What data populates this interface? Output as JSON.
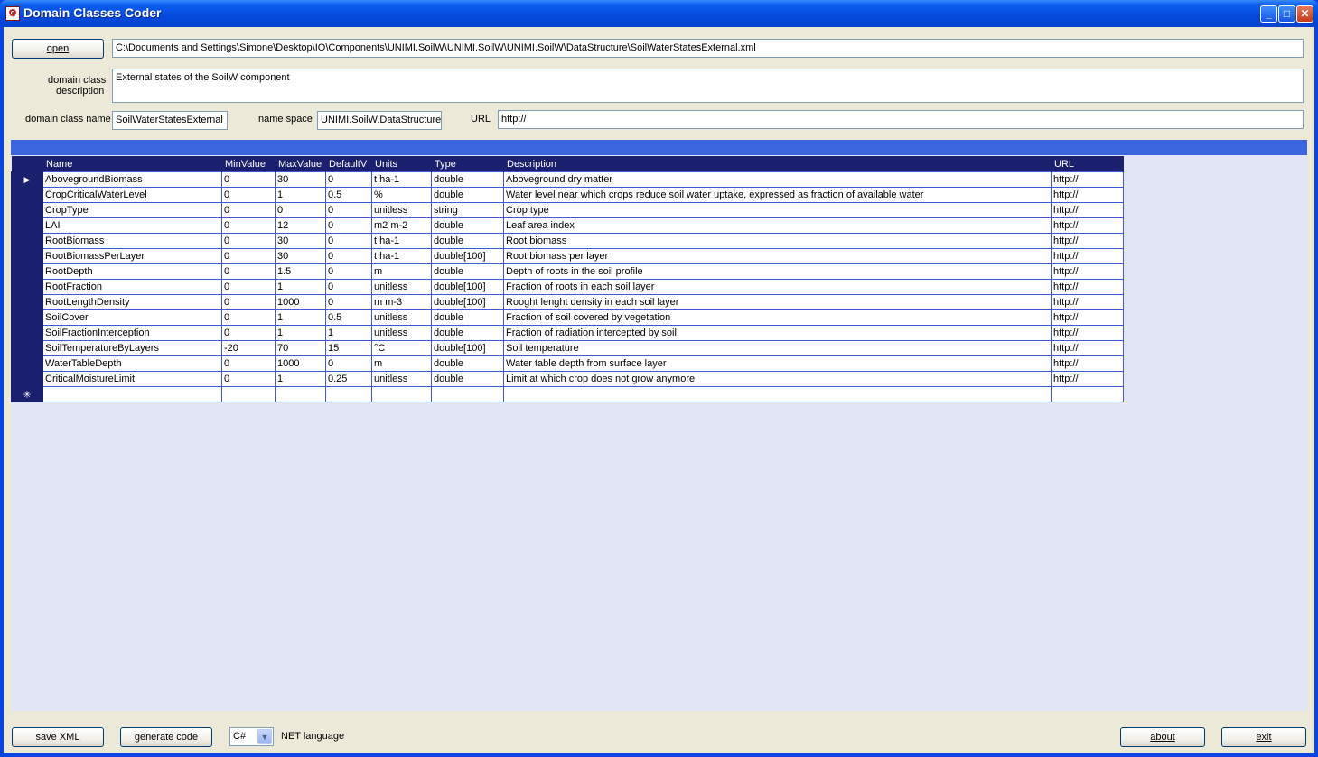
{
  "window": {
    "title": "Domain Classes Coder",
    "controls": {
      "minimize": "_",
      "maximize": "□",
      "close": "✕"
    }
  },
  "form": {
    "open_label": "open",
    "file_path": "C:\\Documents and Settings\\Simone\\Desktop\\IO\\Components\\UNIMI.SoilW\\UNIMI.SoilW\\UNIMI.SoilW\\DataStructure\\SoilWaterStatesExternal.xml",
    "description_label_1": "domain class",
    "description_label_2": "description",
    "description_value": "External states of the SoilW component",
    "class_name_label": "domain class name",
    "class_name_value": "SoilWaterStatesExternal",
    "namespace_label": "name space",
    "namespace_value": "UNIMI.SoilW.DataStructure",
    "url_label": "URL",
    "url_value": "http://"
  },
  "grid": {
    "columns": [
      "Name",
      "MinValue",
      "MaxValue",
      "DefaultV",
      "Units",
      "Type",
      "Description",
      "URL"
    ],
    "current_row_marker": "▶",
    "new_row_marker": "✳",
    "rows": [
      [
        "AbovegroundBiomass",
        "0",
        "30",
        "0",
        "t ha-1",
        "double",
        "Aboveground dry matter",
        "http://"
      ],
      [
        "CropCriticalWaterLevel",
        "0",
        "1",
        "0.5",
        "%",
        "double",
        "Water level near which crops reduce soil water uptake, expressed as fraction of available water",
        "http://"
      ],
      [
        "CropType",
        "0",
        "0",
        "0",
        "unitless",
        "string",
        "Crop type",
        "http://"
      ],
      [
        "LAI",
        "0",
        "12",
        "0",
        "m2 m-2",
        "double",
        "Leaf area index",
        "http://"
      ],
      [
        "RootBiomass",
        "0",
        "30",
        "0",
        "t ha-1",
        "double",
        "Root biomass",
        "http://"
      ],
      [
        "RootBiomassPerLayer",
        "0",
        "30",
        "0",
        "t ha-1",
        "double[100]",
        "Root biomass per layer",
        "http://"
      ],
      [
        "RootDepth",
        "0",
        "1.5",
        "0",
        "m",
        "double",
        "Depth of roots in the soil profile",
        "http://"
      ],
      [
        "RootFraction",
        "0",
        "1",
        "0",
        "unitless",
        "double[100]",
        "Fraction of roots in each soil layer",
        "http://"
      ],
      [
        "RootLengthDensity",
        "0",
        "1000",
        "0",
        "m m-3",
        "double[100]",
        "Rooght lenght density in each soil layer",
        "http://"
      ],
      [
        "SoilCover",
        "0",
        "1",
        "0.5",
        "unitless",
        "double",
        "Fraction of soil covered by vegetation",
        "http://"
      ],
      [
        "SoilFractionInterception",
        "0",
        "1",
        "1",
        "unitless",
        "double",
        "Fraction of radiation intercepted by soil",
        "http://"
      ],
      [
        "SoilTemperatureByLayers",
        "-20",
        "70",
        "15",
        "°C",
        "double[100]",
        "Soil temperature",
        "http://"
      ],
      [
        "WaterTableDepth",
        "0",
        "1000",
        "0",
        "m",
        "double",
        "Water table depth from surface layer",
        "http://"
      ],
      [
        "CriticalMoistureLimit",
        "0",
        "1",
        "0.25",
        "unitless",
        "double",
        "Limit at which crop does not grow anymore",
        "http://"
      ]
    ]
  },
  "footer": {
    "save_xml_label": "save XML",
    "generate_code_label": "generate code",
    "language_value": "C#",
    "language_label": "NET language",
    "about_label": "about",
    "exit_label": "exit"
  },
  "colors": {
    "titlebar": "#0449dc",
    "grid_header": "#1a1f6e",
    "grid_caption": "#3b66e0",
    "grid_background": "#e2e5f5"
  }
}
